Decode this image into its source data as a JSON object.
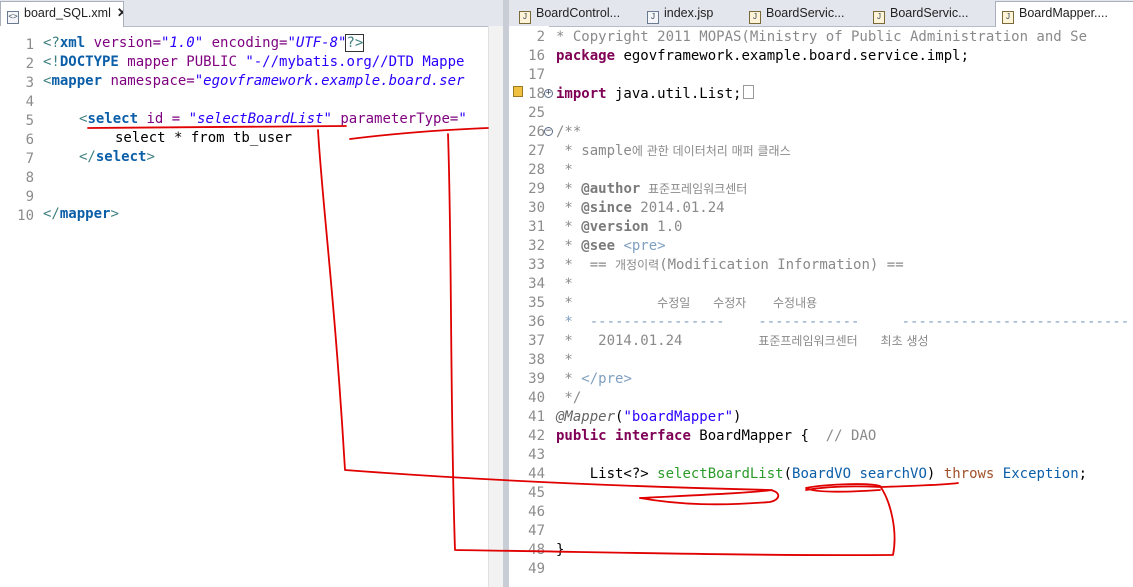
{
  "left_editor": {
    "tab": {
      "label": "board_SQL.xml",
      "close_icon": "close-icon"
    },
    "line_numbers": [
      "1",
      "2",
      "3",
      "4",
      "5",
      "6",
      "7",
      "8",
      "9",
      "10"
    ],
    "lines": {
      "l1a": "<?",
      "l1b": "xml",
      "l1c": " version=",
      "l1d": "\"1.0\"",
      "l1e": " encoding=",
      "l1f": "\"UTF-8\"",
      "l1g": "?>",
      "l2a": "<!",
      "l2b": "DOCTYPE",
      "l2c": " mapper PUBLIC ",
      "l2d": "\"-//mybatis.org//DTD Mappe",
      "l3a": "<",
      "l3b": "mapper",
      "l3c": " namespace=",
      "l3d": "\"egovframework.example.board.ser",
      "l5a": "<",
      "l5b": "select",
      "l5c": " id",
      "l5d": " = ",
      "l5e": "\"selectBoardList\"",
      "l5f": " parameterType=",
      "l5g": "\"",
      "l6": "select * from tb_user",
      "l7a": "</",
      "l7b": "select",
      "l7c": ">",
      "l10a": "</",
      "l10b": "mapper",
      "l10c": ">"
    }
  },
  "right_editor": {
    "tabs": [
      {
        "label": "BoardControl...",
        "icon": "java-file-icon"
      },
      {
        "label": "index.jsp",
        "icon": "jsp-file-icon"
      },
      {
        "label": "BoardServic...",
        "icon": "java-file-icon"
      },
      {
        "label": "BoardServic...",
        "icon": "java-file-icon"
      },
      {
        "label": "BoardMapper....",
        "icon": "java-file-icon",
        "active": true
      }
    ],
    "line_numbers": [
      "2",
      "16",
      "17",
      "18",
      "25",
      "26",
      "27",
      "28",
      "29",
      "30",
      "31",
      "32",
      "33",
      "34",
      "35",
      "36",
      "37",
      "38",
      "39",
      "40",
      "41",
      "42",
      "43",
      "44",
      "45",
      "46",
      "47",
      "48",
      "49"
    ],
    "lines": {
      "r2": "* Copyright 2011 MOPAS(Ministry of Public Administration and Se",
      "r16a": "package",
      "r16b": " egovframework.example.board.service.impl;",
      "r18a": "import",
      "r18b": " java.util.List;",
      "r26": "/**",
      "r27a": " * sample",
      "r27b": "에 관한 데이터처리 매퍼 클래스",
      "r28": " *",
      "r29a": " * ",
      "r29b": "@author",
      "r29c": "  표준프레임워크센터",
      "r30a": " * ",
      "r30b": "@since",
      "r30c": " 2014.01.24",
      "r31a": " * ",
      "r31b": "@version",
      "r31c": " 1.0",
      "r32a": " * ",
      "r32b": "@see",
      "r32c": " <pre>",
      "r33a": " *  == ",
      "r33b": "개정이력",
      "r33c": "(Modification Information) ==",
      "r34": " *",
      "r35a": " *          ",
      "r35b": "수정일      수정자       수정내용",
      "r36": " *  ----------------    ------------     ---------------------------",
      "r37a": " *   2014.01.24         ",
      "r37b": "표준프레임워크센터      최초 생성",
      "r38": " *",
      "r39a": " * ",
      "r39b": "</pre>",
      "r40": " */",
      "r41a": "@Mapper",
      "r41b": "(",
      "r41c": "\"boardMapper\"",
      "r41d": ")",
      "r42a": "public",
      "r42b": " ",
      "r42c": "interface",
      "r42d": " BoardMapper {  ",
      "r42e": "// DAO",
      "r44a": "    List<?> ",
      "r44b": "selectBoardList",
      "r44c": "(",
      "r44d": "BoardVO",
      "r44e": " ",
      "r44f": "searchVO",
      "r44g": ") ",
      "r44h": "throws",
      "r44i": " ",
      "r44j": "Exception",
      "r44k": ";",
      "r48": "}"
    }
  },
  "colors": {
    "annotation_stroke": "#e00000",
    "tabbar_bg": "#e3e6ec",
    "gutter_text": "#8c8c8c",
    "keyword": "#7f0055"
  }
}
